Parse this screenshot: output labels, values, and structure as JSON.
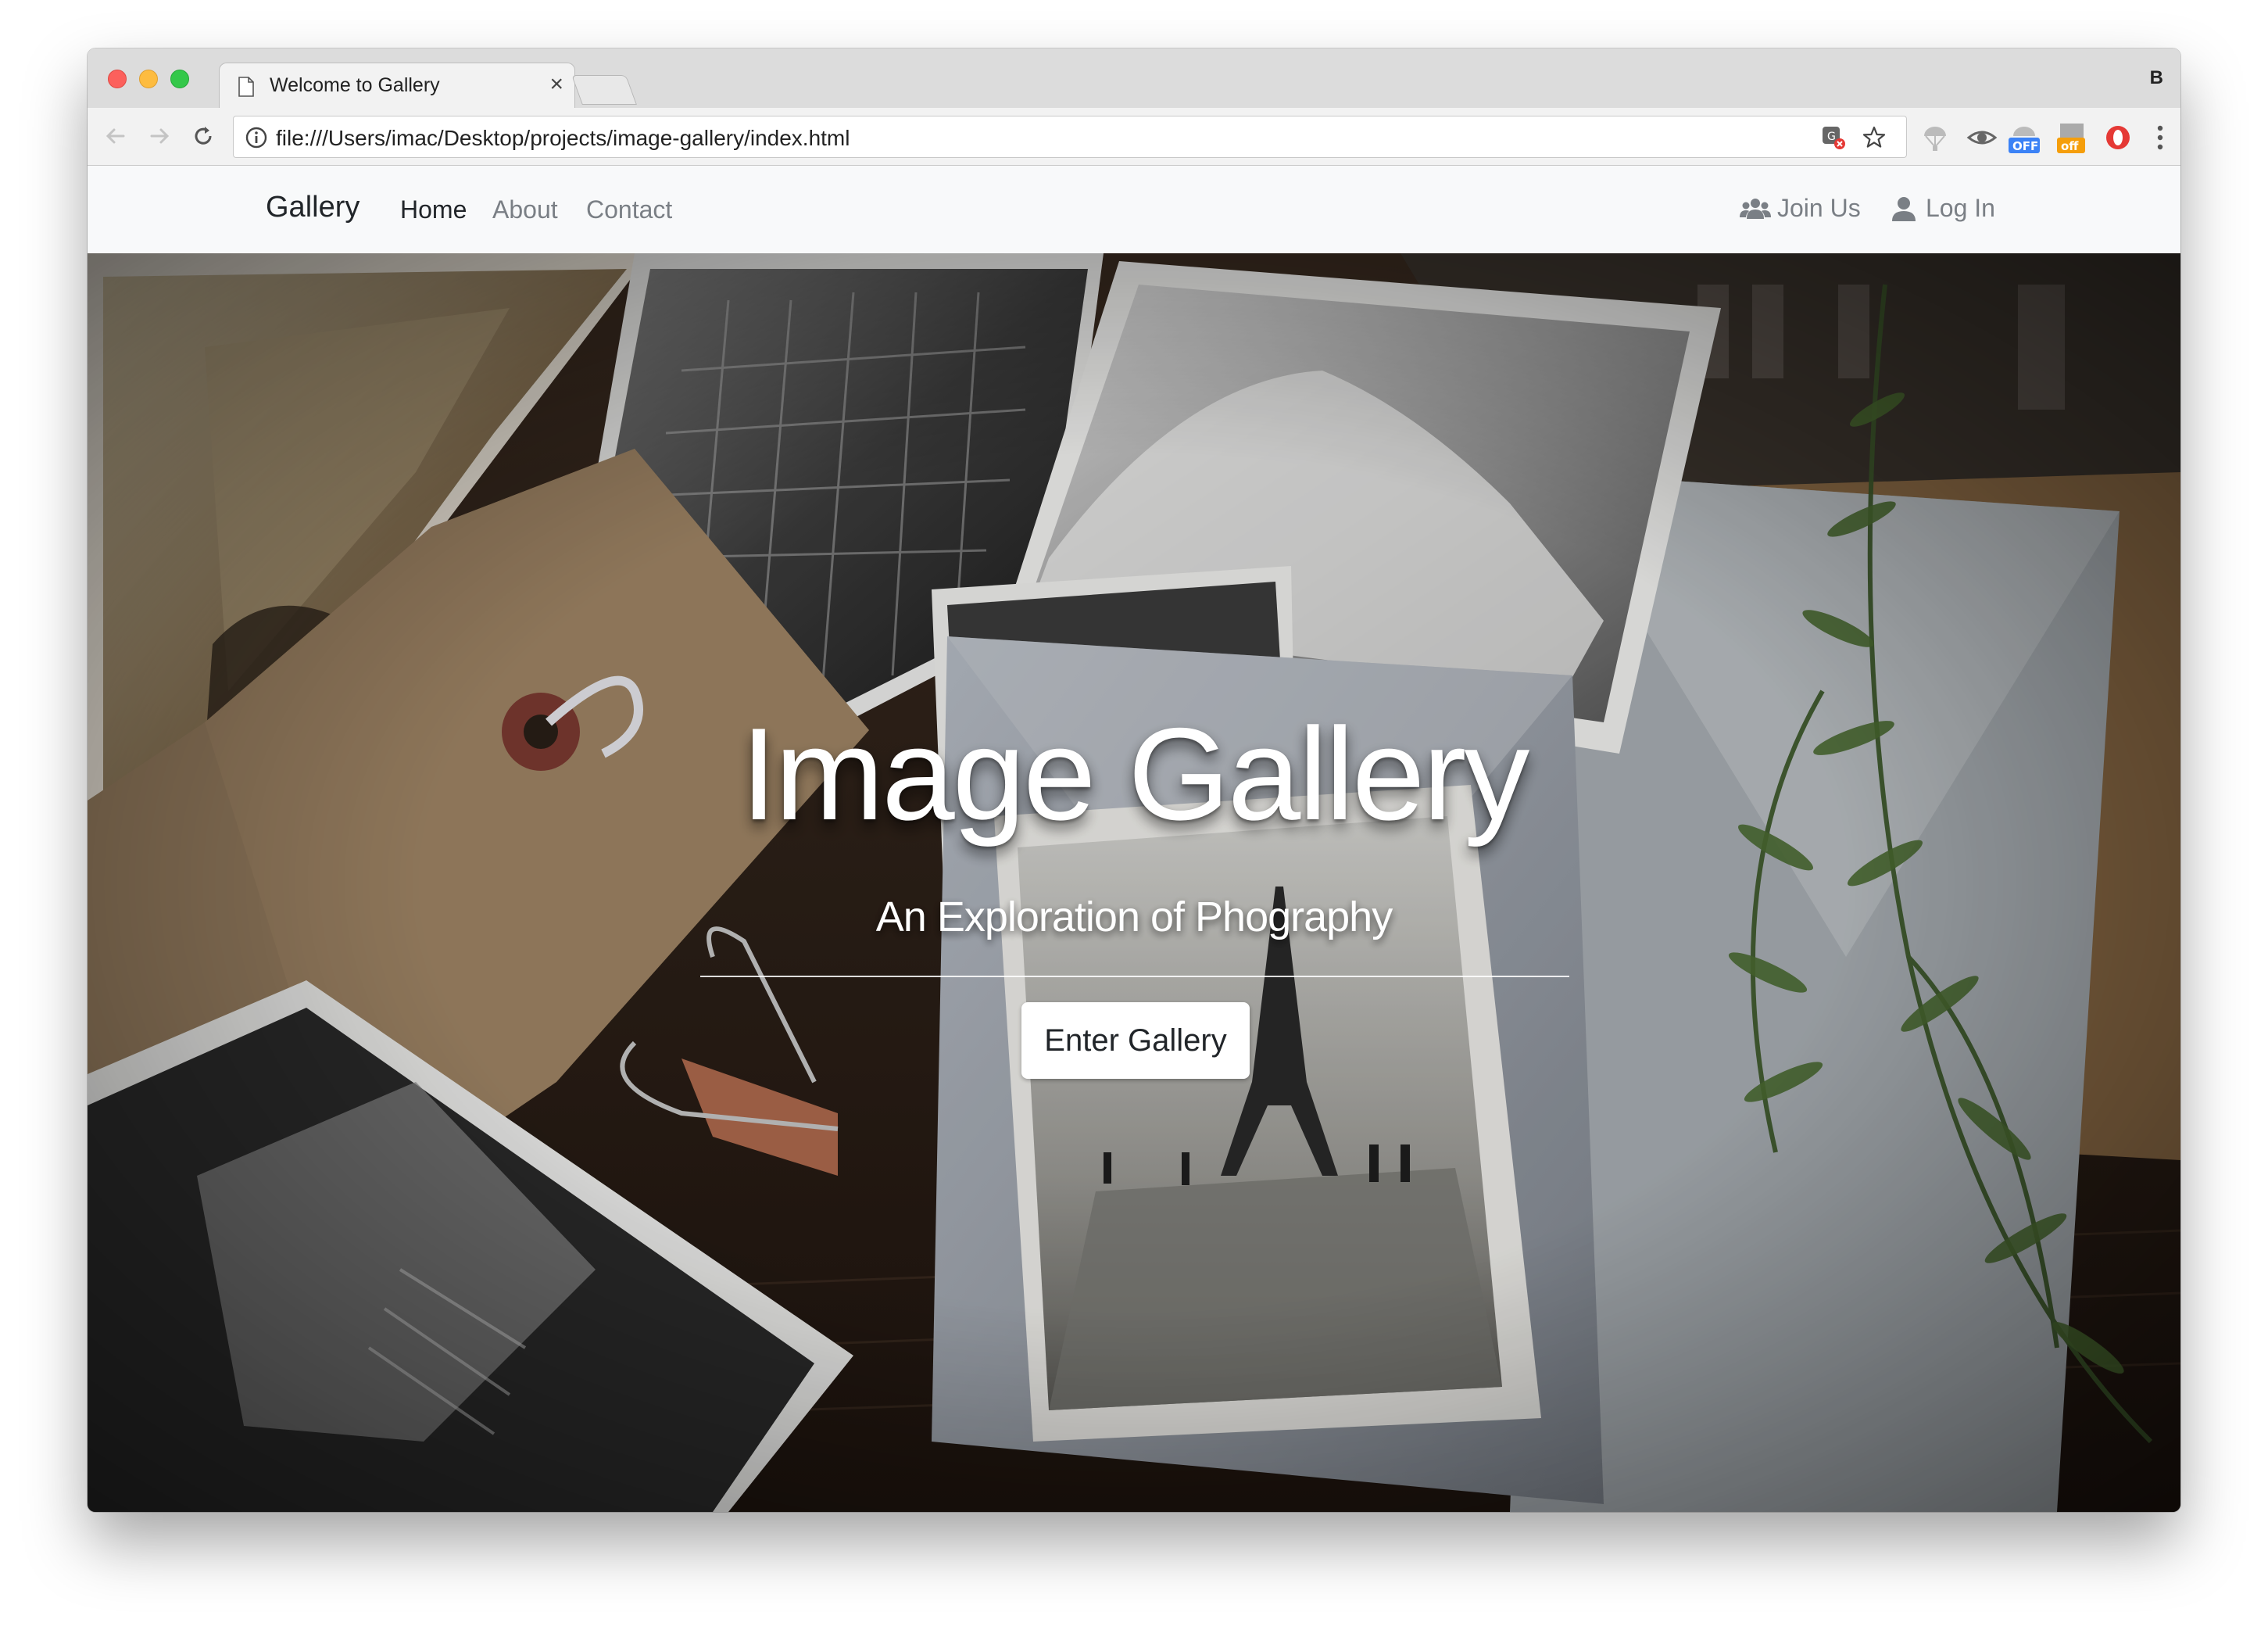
{
  "browser": {
    "tab_title": "Welcome to Gallery",
    "tab_close": "×",
    "profile_letter": "B",
    "url": "file:///Users/imac/Desktop/projects/image-gallery/index.html",
    "extensions": [
      "translate-icon",
      "star-icon",
      "parachute-icon",
      "eye-icon",
      "off-badge-icon",
      "off-coupon-icon",
      "opera-icon",
      "menu-dots-icon"
    ],
    "extension_badges": {
      "off_blue": "OFF",
      "off_orange": "off"
    }
  },
  "navbar": {
    "brand": "Gallery",
    "links": [
      {
        "label": "Home",
        "active": true
      },
      {
        "label": "About",
        "active": false
      },
      {
        "label": "Contact",
        "active": false
      }
    ],
    "join_label": "Join Us",
    "login_label": "Log In"
  },
  "hero": {
    "title": "Image Gallery",
    "subtitle": "An Exploration of Phography",
    "button_label": "Enter Gallery"
  },
  "colors": {
    "tab_strip": "#dcdcdc",
    "navbar_bg": "#f8f9fa",
    "nav_text": "#212529",
    "nav_muted": "#7a7f85",
    "hero_text": "#ffffff"
  }
}
